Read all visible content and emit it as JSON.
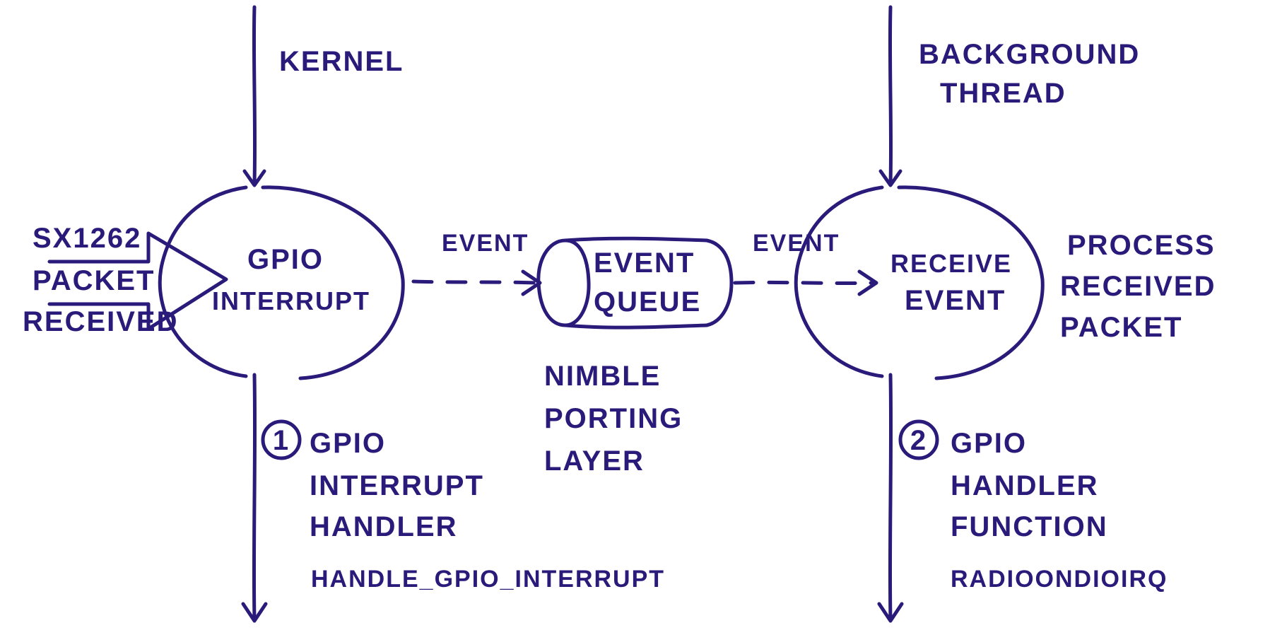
{
  "labels": {
    "kernel": "KERNEL",
    "background1": "BACKGROUND",
    "background2": "THREAD",
    "input1": "SX1262",
    "input2": "PACKET",
    "input3": "RECEIVED",
    "leftCircle1": "GPIO",
    "leftCircle2": "INTERRUPT",
    "eventLeft": "EVENT",
    "queue1": "EVENT",
    "queue2": "QUEUE",
    "nimble1": "NIMBLE",
    "nimble2": "PORTING",
    "nimble3": "LAYER",
    "eventRight": "EVENT",
    "rightCircle1": "RECEIVE",
    "rightCircle2": "EVENT",
    "output1": "PROCESS",
    "output2": "RECEIVED",
    "output3": "PACKET",
    "step1a": "GPIO",
    "step1b": "INTERRUPT",
    "step1c": "HANDLER",
    "step1d": "HANDLE_GPIO_INTERRUPT",
    "step2a": "GPIO",
    "step2b": "HANDLER",
    "step2c": "FUNCTION",
    "step2d": "RADIOONDIOIRQ"
  }
}
